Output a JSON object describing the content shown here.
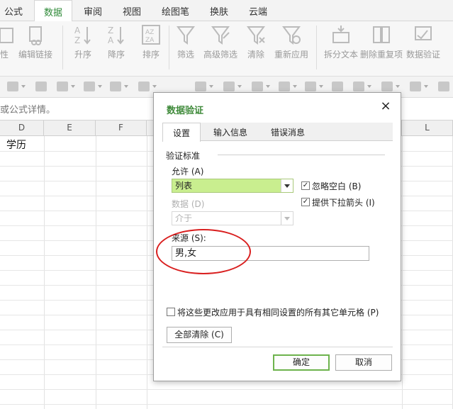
{
  "ribbon_tabs": [
    {
      "label": "公式"
    },
    {
      "label": "数据"
    },
    {
      "label": "审阅"
    },
    {
      "label": "视图"
    },
    {
      "label": "绘图笔"
    },
    {
      "label": "换肤"
    },
    {
      "label": "云端"
    }
  ],
  "ribbon_buttons": [
    {
      "label": "性",
      "icon": "attribute-icon"
    },
    {
      "label": "编辑链接",
      "icon": "edit-link-icon"
    },
    {
      "label": "升序",
      "icon": "sort-ascending-icon"
    },
    {
      "label": "降序",
      "icon": "sort-descending-icon"
    },
    {
      "label": "排序",
      "icon": "sort-icon"
    },
    {
      "label": "筛选",
      "icon": "filter-icon"
    },
    {
      "label": "高级筛选",
      "icon": "advanced-filter-icon"
    },
    {
      "label": "清除",
      "icon": "clear-filter-icon"
    },
    {
      "label": "重新应用",
      "icon": "reapply-filter-icon"
    },
    {
      "label": "拆分文本",
      "icon": "split-text-icon"
    },
    {
      "label": "删除重复项",
      "icon": "remove-duplicates-icon"
    },
    {
      "label": "数据验证",
      "icon": "data-validation-icon"
    }
  ],
  "hint_text": "或公式详情。",
  "columns": [
    "D",
    "E",
    "F",
    "L"
  ],
  "cell_d1": "学历",
  "dialog": {
    "title": "数据验证",
    "close": "×",
    "tabs": [
      "设置",
      "输入信息",
      "错误消息"
    ],
    "section_title": "验证标准",
    "allow_label": "允许 (A)",
    "allow_value": "列表",
    "ignore_blank_label": "忽略空白 (B)",
    "ignore_blank_checked": true,
    "dropdown_label": "提供下拉箭头 (I)",
    "dropdown_checked": true,
    "data_label": "数据 (D)",
    "data_value": "介于",
    "source_label": "来源 (S):",
    "source_value": "男,女",
    "apply_all_label": "将这些更改应用于具有相同设置的所有其它单元格 (P)",
    "apply_all_checked": false,
    "clear_all": "全部清除 (C)",
    "ok": "确定",
    "cancel": "取消"
  },
  "colors": {
    "accent_green": "#3f8a3a",
    "list_highlight": "#c9ee8f",
    "annotation_red": "#d91f1f"
  }
}
